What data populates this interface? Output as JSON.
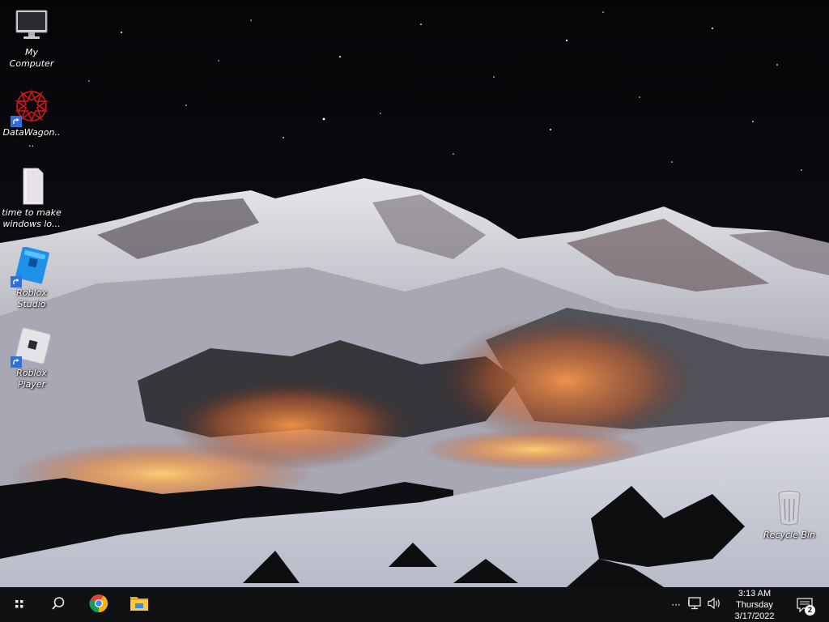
{
  "desktop": {
    "icons": [
      {
        "label": "My Computer",
        "icon": "monitor-icon"
      },
      {
        "label": "DataWagon....",
        "icon": "datawagon-logo-icon"
      },
      {
        "label": "time to make windows lo...",
        "icon": "text-file-icon"
      },
      {
        "label": "Roblox Studio",
        "icon": "roblox-studio-icon"
      },
      {
        "label": "Roblox Player",
        "icon": "roblox-player-icon"
      },
      {
        "label": "Recycle Bin",
        "icon": "recycle-bin-icon"
      }
    ]
  },
  "taskbar": {
    "pinned": [
      "start-icon",
      "search-icon",
      "chrome-icon",
      "file-explorer-icon"
    ],
    "tray": {
      "overflow": "···",
      "icons": [
        "network-icon",
        "volume-icon"
      ],
      "notifications_count": "2"
    },
    "clock": {
      "time": "3:13 AM",
      "day": "Thursday",
      "date": "3/17/2022"
    }
  }
}
